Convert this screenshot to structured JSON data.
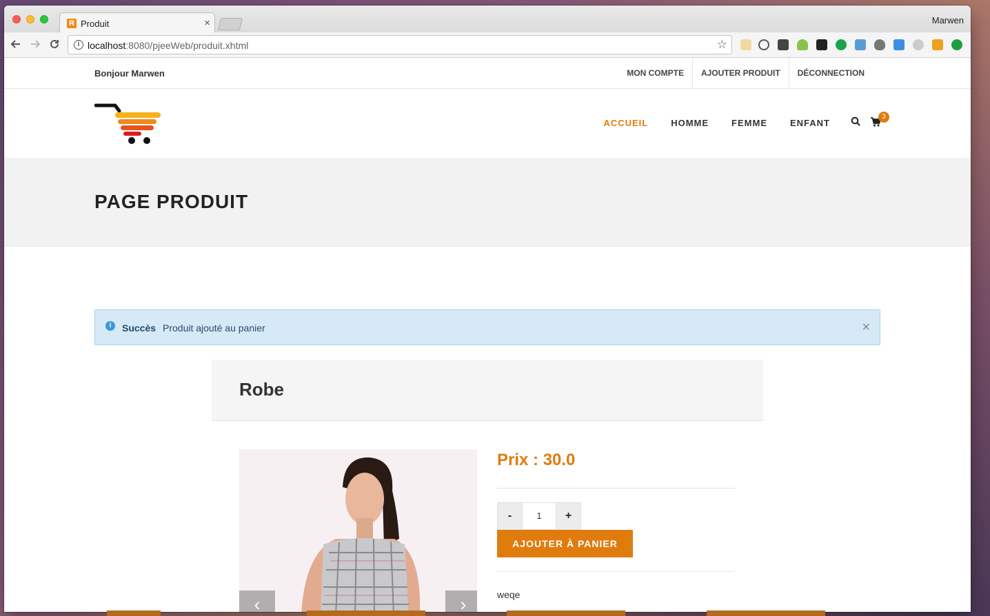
{
  "browser": {
    "tab_title": "Produit",
    "tab_favicon": "R",
    "tab_close": "×",
    "profile_name": "Marwen",
    "url_host": "localhost",
    "url_path": ":8080/pjeeWeb/produit.xhtml"
  },
  "site": {
    "greeting": "Bonjour Marwen",
    "top_nav": [
      "MON COMPTE",
      "AJOUTER PRODUIT",
      "DÉCONNECTION"
    ],
    "main_nav": [
      "ACCUEIL",
      "HOMME",
      "FEMME",
      "ENFANT"
    ],
    "active_nav": "ACCUEIL",
    "cart_count": "3",
    "accent_color": "#e07c0e"
  },
  "hero": {
    "title": "PAGE PRODUIT"
  },
  "alert": {
    "icon": "i",
    "title": "Succès",
    "message": "Produit ajouté au panier",
    "close": "×"
  },
  "product": {
    "name": "Robe",
    "price_label": "Prix : 30.0",
    "qty_minus": "-",
    "qty_value": "1",
    "qty_plus": "+",
    "add_to_cart": "AJOUTER À PANIER",
    "description": "weqe",
    "prev_arrow": "‹",
    "next_arrow": "›"
  }
}
